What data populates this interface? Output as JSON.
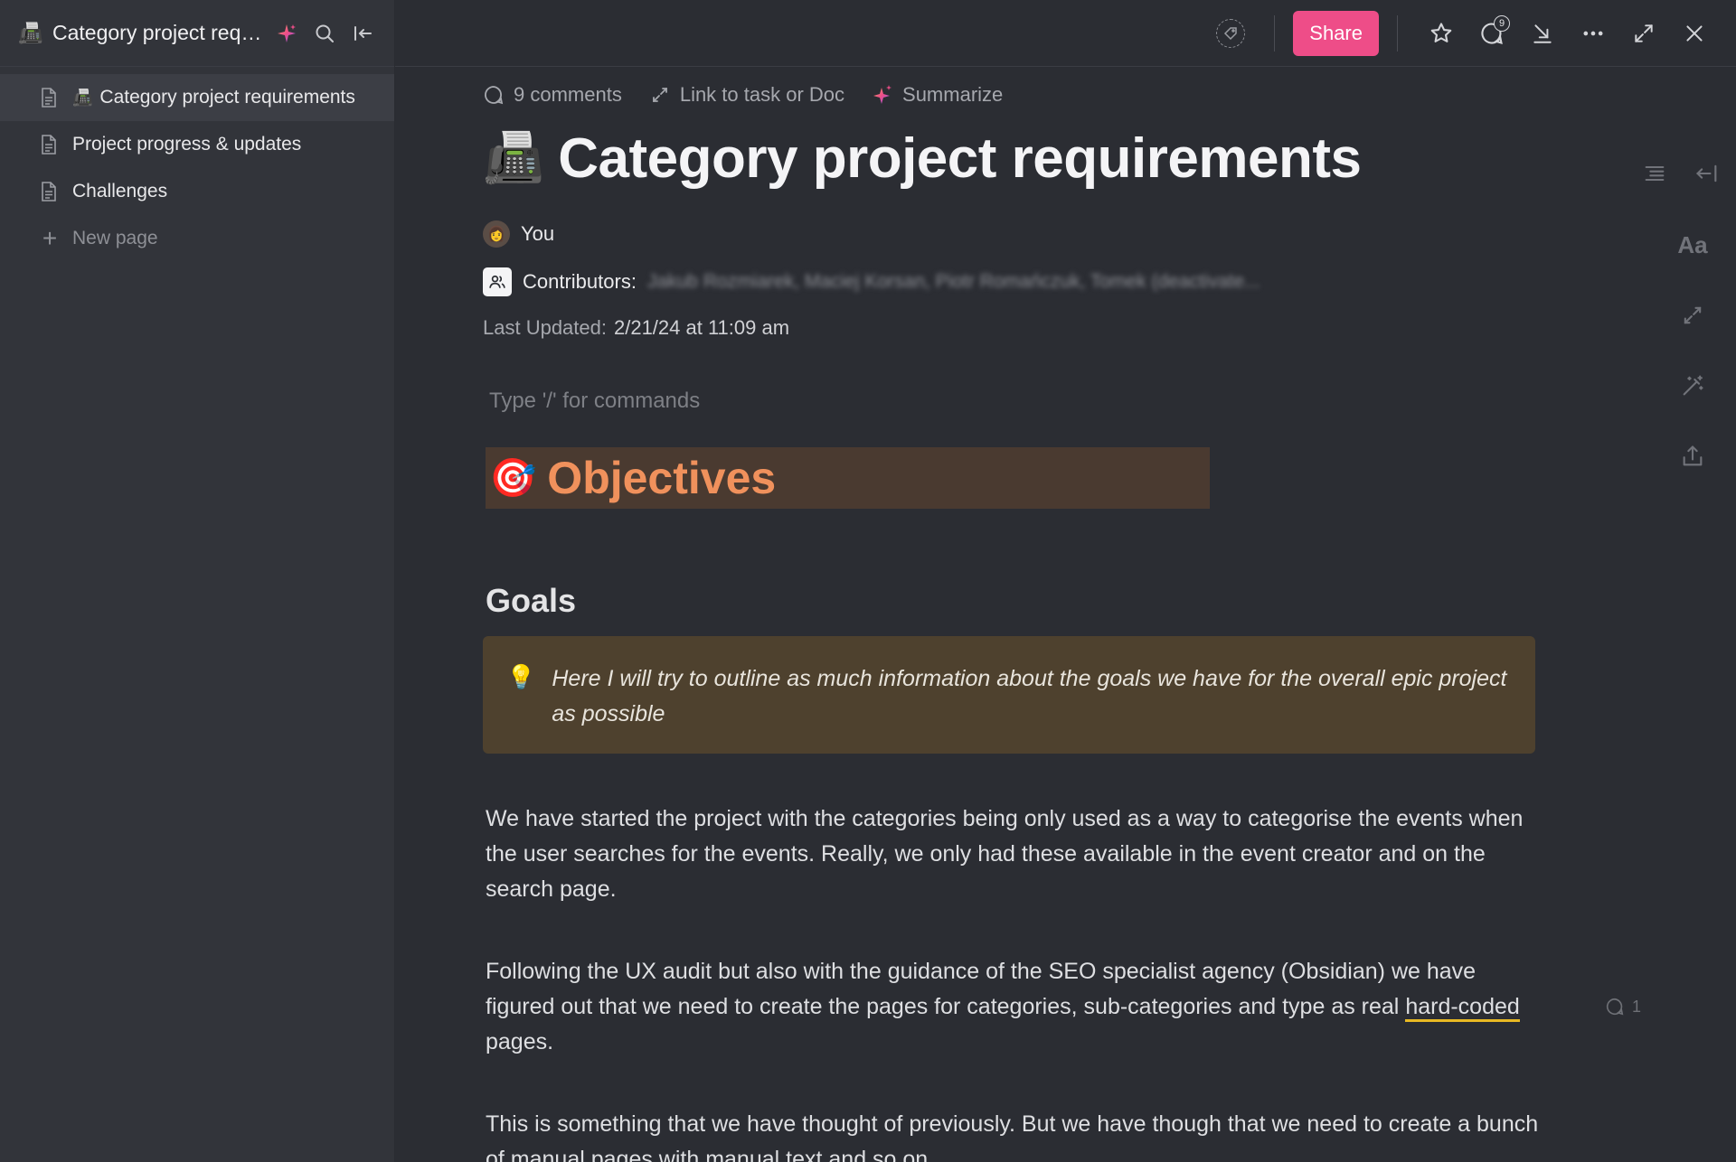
{
  "sidebar": {
    "header": {
      "emoji": "📠",
      "title": "Category project requ..."
    },
    "items": [
      {
        "emoji": "📠",
        "label": "Category project requirements",
        "active": true
      },
      {
        "label": "Project progress & updates"
      },
      {
        "label": "Challenges"
      }
    ],
    "new_page_label": "New page"
  },
  "topbar": {
    "share_label": "Share",
    "comments_badge": "9"
  },
  "doc": {
    "meta": {
      "comments_label": "9 comments",
      "link_label": "Link to task or Doc",
      "summarize_label": "Summarize"
    },
    "emoji": "📠",
    "title": "Category project requirements",
    "author": "You",
    "contributors_label": "Contributors:",
    "contributors_value": "Jakub Rozmiarek, Maciej Korsan, Piotr Romańczuk, Tomek (deactivate...",
    "updated_label": "Last Updated:",
    "updated_value": "2/21/24 at 11:09 am",
    "placeholder": "Type '/' for commands",
    "objectives_emoji": "🎯",
    "objectives": "Objectives",
    "goals": "Goals",
    "callout_emoji": "💡",
    "callout": "Here I will try to outline as much information about the goals we have for the overall epic project as possible",
    "para1": "We have started the project with the categories being only used as a way to categorise the events when the user searches for the events. Really, we only had these available in the event creator and on the search page.",
    "para2_start": "Following the UX audit but also with the guidance of the SEO specialist agency (Obsidian) we have figured out that we need to create the pages for categories, sub-categories and type as real ",
    "para2_highlight": "hard-coded",
    "para2_end": " pages.",
    "para3": "This is something that we have thought of previously. But we have though that we need to create a bunch of manual pages with manual text and so on.",
    "inline_comment_count": "1"
  },
  "rail": {
    "font_label": "Aa"
  },
  "colors": {
    "accent_share": "#ee4d88",
    "objectives_bg": "#4a3a30",
    "objectives_text": "#f0915c",
    "callout_bg": "#4e412e",
    "highlight_underline": "#e8b923"
  }
}
